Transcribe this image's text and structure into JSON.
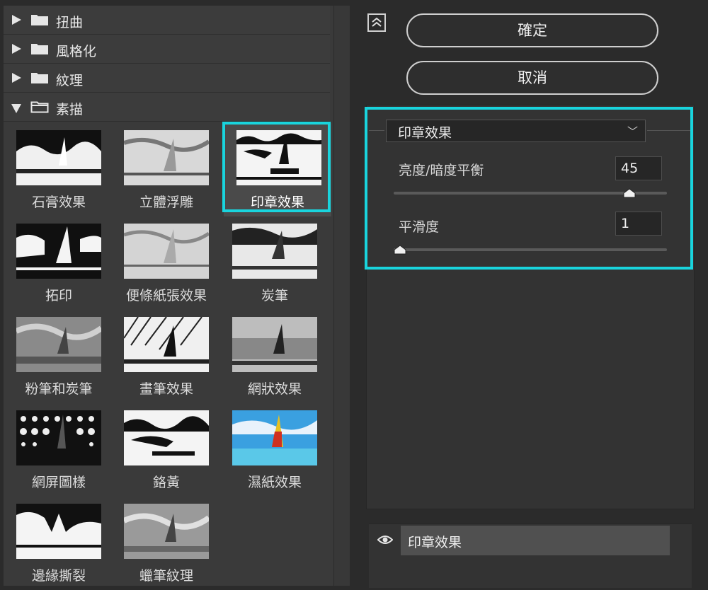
{
  "categories": [
    {
      "label": "扭曲",
      "expanded": false
    },
    {
      "label": "風格化",
      "expanded": false
    },
    {
      "label": "紋理",
      "expanded": false
    },
    {
      "label": "素描",
      "expanded": true
    }
  ],
  "filters": [
    {
      "label": "石膏效果",
      "selected": false
    },
    {
      "label": "立體浮雕",
      "selected": false
    },
    {
      "label": "印章效果",
      "selected": true
    },
    {
      "label": "拓印",
      "selected": false
    },
    {
      "label": "便條紙張效果",
      "selected": false
    },
    {
      "label": "炭筆",
      "selected": false
    },
    {
      "label": "粉筆和炭筆",
      "selected": false
    },
    {
      "label": "畫筆效果",
      "selected": false
    },
    {
      "label": "網狀效果",
      "selected": false
    },
    {
      "label": "網屏圖樣",
      "selected": false
    },
    {
      "label": "鉻黃",
      "selected": false
    },
    {
      "label": "濕紙效果",
      "selected": false
    },
    {
      "label": "邊緣撕裂",
      "selected": false
    },
    {
      "label": "蠟筆紋理",
      "selected": false
    }
  ],
  "buttons": {
    "ok": "確定",
    "cancel": "取消"
  },
  "settings": {
    "filter_select": "印章效果",
    "params": [
      {
        "label": "亮度/暗度平衡",
        "value": "45",
        "fraction": 0.88
      },
      {
        "label": "平滑度",
        "value": "1",
        "fraction": 0.0
      }
    ]
  },
  "layers": {
    "name": "印章效果"
  },
  "colors": {
    "highlight": "#19d4dd",
    "panel": "#3a3a3a",
    "background": "#2b2b2b"
  },
  "icons": [
    "folder-icon",
    "eye-icon",
    "collapse-icon",
    "chevron-down-icon"
  ]
}
